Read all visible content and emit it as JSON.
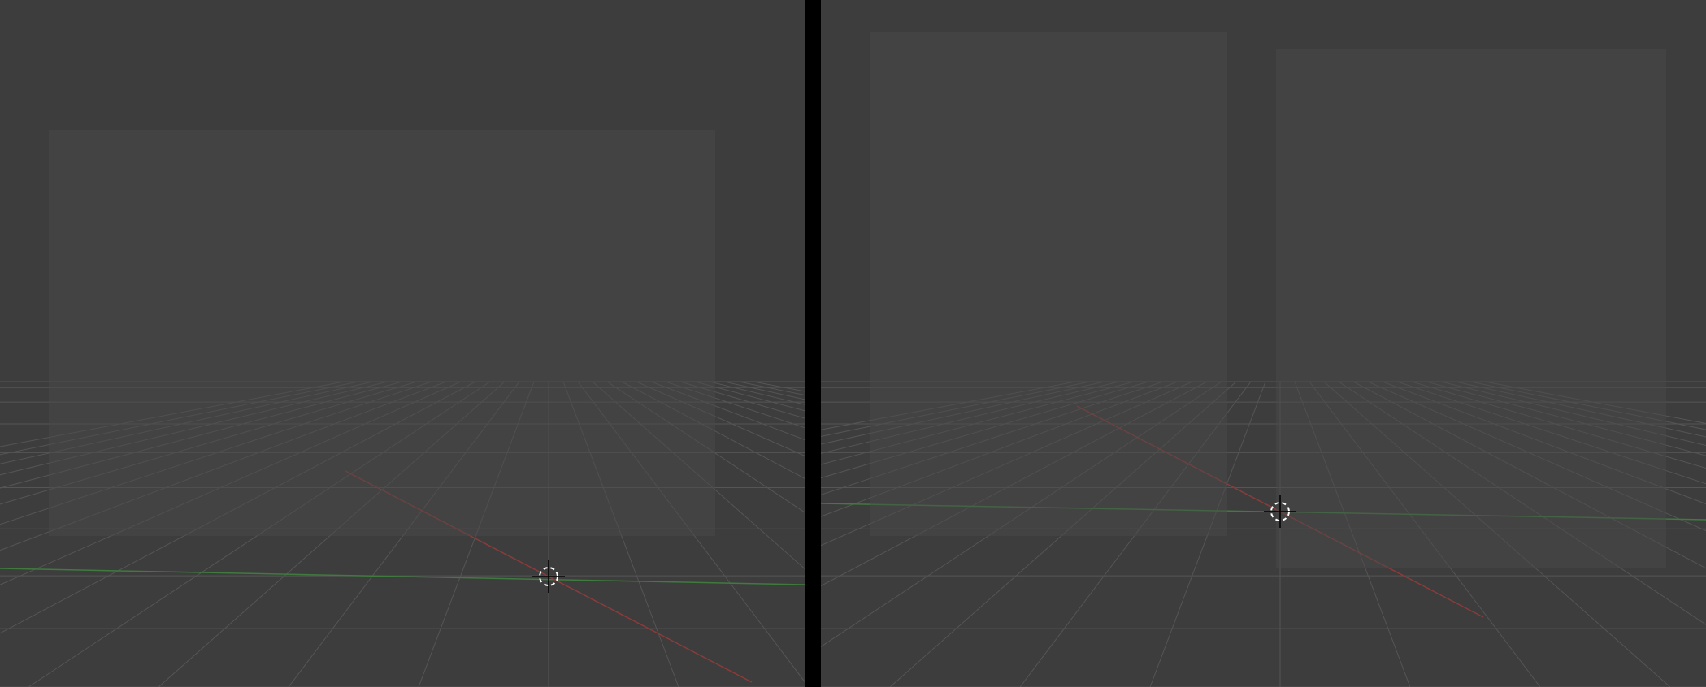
{
  "viewports": [
    {
      "name": "left-3d-viewport",
      "background": "#3d3d3d",
      "grid_color": "#555555",
      "x_axis_color": "#8a3b3b",
      "y_axis_color": "#3f7a3f",
      "cursor_icon": "3d-cursor-icon"
    },
    {
      "name": "right-3d-viewport",
      "background": "#3d3d3d",
      "grid_color": "#555555",
      "x_axis_color": "#8a3b3b",
      "y_axis_color": "#3f7a3f",
      "cursor_icon": "3d-cursor-icon"
    }
  ],
  "divider_color": "#000000",
  "placeholder_color": "#4a4a4a"
}
